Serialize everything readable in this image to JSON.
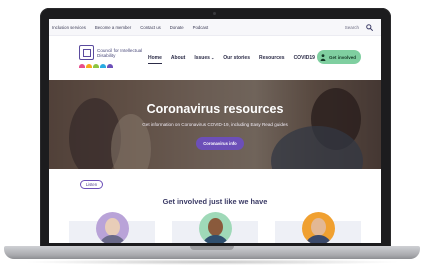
{
  "utility_bar": {
    "links": [
      "Inclusion services",
      "Become a member",
      "Contact us",
      "Donate",
      "Podcast"
    ],
    "search_label": "Search"
  },
  "header": {
    "logo_text": "Council for Intellectual Disability",
    "nav": [
      {
        "label": "Home",
        "active": true
      },
      {
        "label": "About",
        "active": false
      },
      {
        "label": "Issues",
        "active": false,
        "has_dropdown": true
      },
      {
        "label": "Our stories",
        "active": false
      },
      {
        "label": "Resources",
        "active": false
      },
      {
        "label": "COVID19",
        "active": false
      }
    ],
    "cta_label": "Get involved"
  },
  "hero": {
    "title": "Coronavirus resources",
    "subtitle": "Get information on Coronavirus COVID-19, including Easy Read guides",
    "button_label": "Coronavirus info"
  },
  "lower": {
    "language_label": "Listen",
    "section_title": "Get involved just like we have"
  },
  "colors": {
    "brand_purple": "#6c4fb8",
    "accent_green": "#7fcfa0",
    "navy_text": "#2c2c48",
    "logo_dots": [
      "#e84c8b",
      "#f7a81b",
      "#8dc63f",
      "#29abe2",
      "#6c4fb8"
    ]
  },
  "icons": {
    "search": "search-icon",
    "get_involved": "person-icon",
    "dropdown": "chevron-down-icon"
  }
}
